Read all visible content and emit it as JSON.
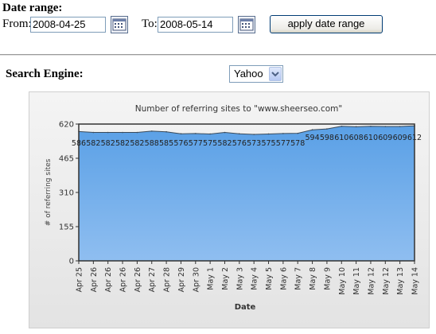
{
  "date_range": {
    "title": "Date range:",
    "from_label": "From:",
    "from_value": "2008-04-25",
    "to_label": "To:",
    "to_value": "2008-05-14",
    "apply_label": "apply date range"
  },
  "search_engine": {
    "label": "Search Engine:",
    "selected": "Yahoo"
  },
  "chart_data": {
    "type": "area",
    "title": "Number of referring sites to \"www.sheerseo.com\"",
    "xlabel": "Date",
    "ylabel": "# of referring sites",
    "ylim": [
      0,
      620
    ],
    "yticks": [
      0,
      155,
      310,
      465,
      620
    ],
    "grid": false,
    "colors": {
      "fill_top": "#5aa0e6",
      "fill_bottom": "#8fbef0",
      "line": "#3a4a5a",
      "frame": "#333333"
    },
    "categories": [
      "Apr 25",
      "Apr 26",
      "Apr 26",
      "Apr 26",
      "Apr 26",
      "Apr 27",
      "Apr 28",
      "Apr 29",
      "Apr 30",
      "May 1",
      "May 2",
      "May 3",
      "May 4",
      "May 5",
      "May 6",
      "May 7",
      "May 8",
      "May 9",
      "May 10",
      "May 11",
      "May 12",
      "May 12",
      "May 13",
      "May 14"
    ],
    "values": [
      586,
      582,
      582,
      582,
      582,
      588,
      585,
      576,
      577,
      575,
      582,
      576,
      573,
      575,
      577,
      578,
      594,
      598,
      610,
      608,
      610,
      609,
      609,
      612
    ],
    "value_labels": [
      "586",
      "582",
      "582",
      "582",
      "582",
      "588",
      "585",
      "576",
      "577",
      "575",
      "582",
      "576",
      "573",
      "575",
      "577",
      "578",
      "594",
      "598",
      "610",
      "608",
      "610",
      "609",
      "609",
      "612"
    ]
  }
}
